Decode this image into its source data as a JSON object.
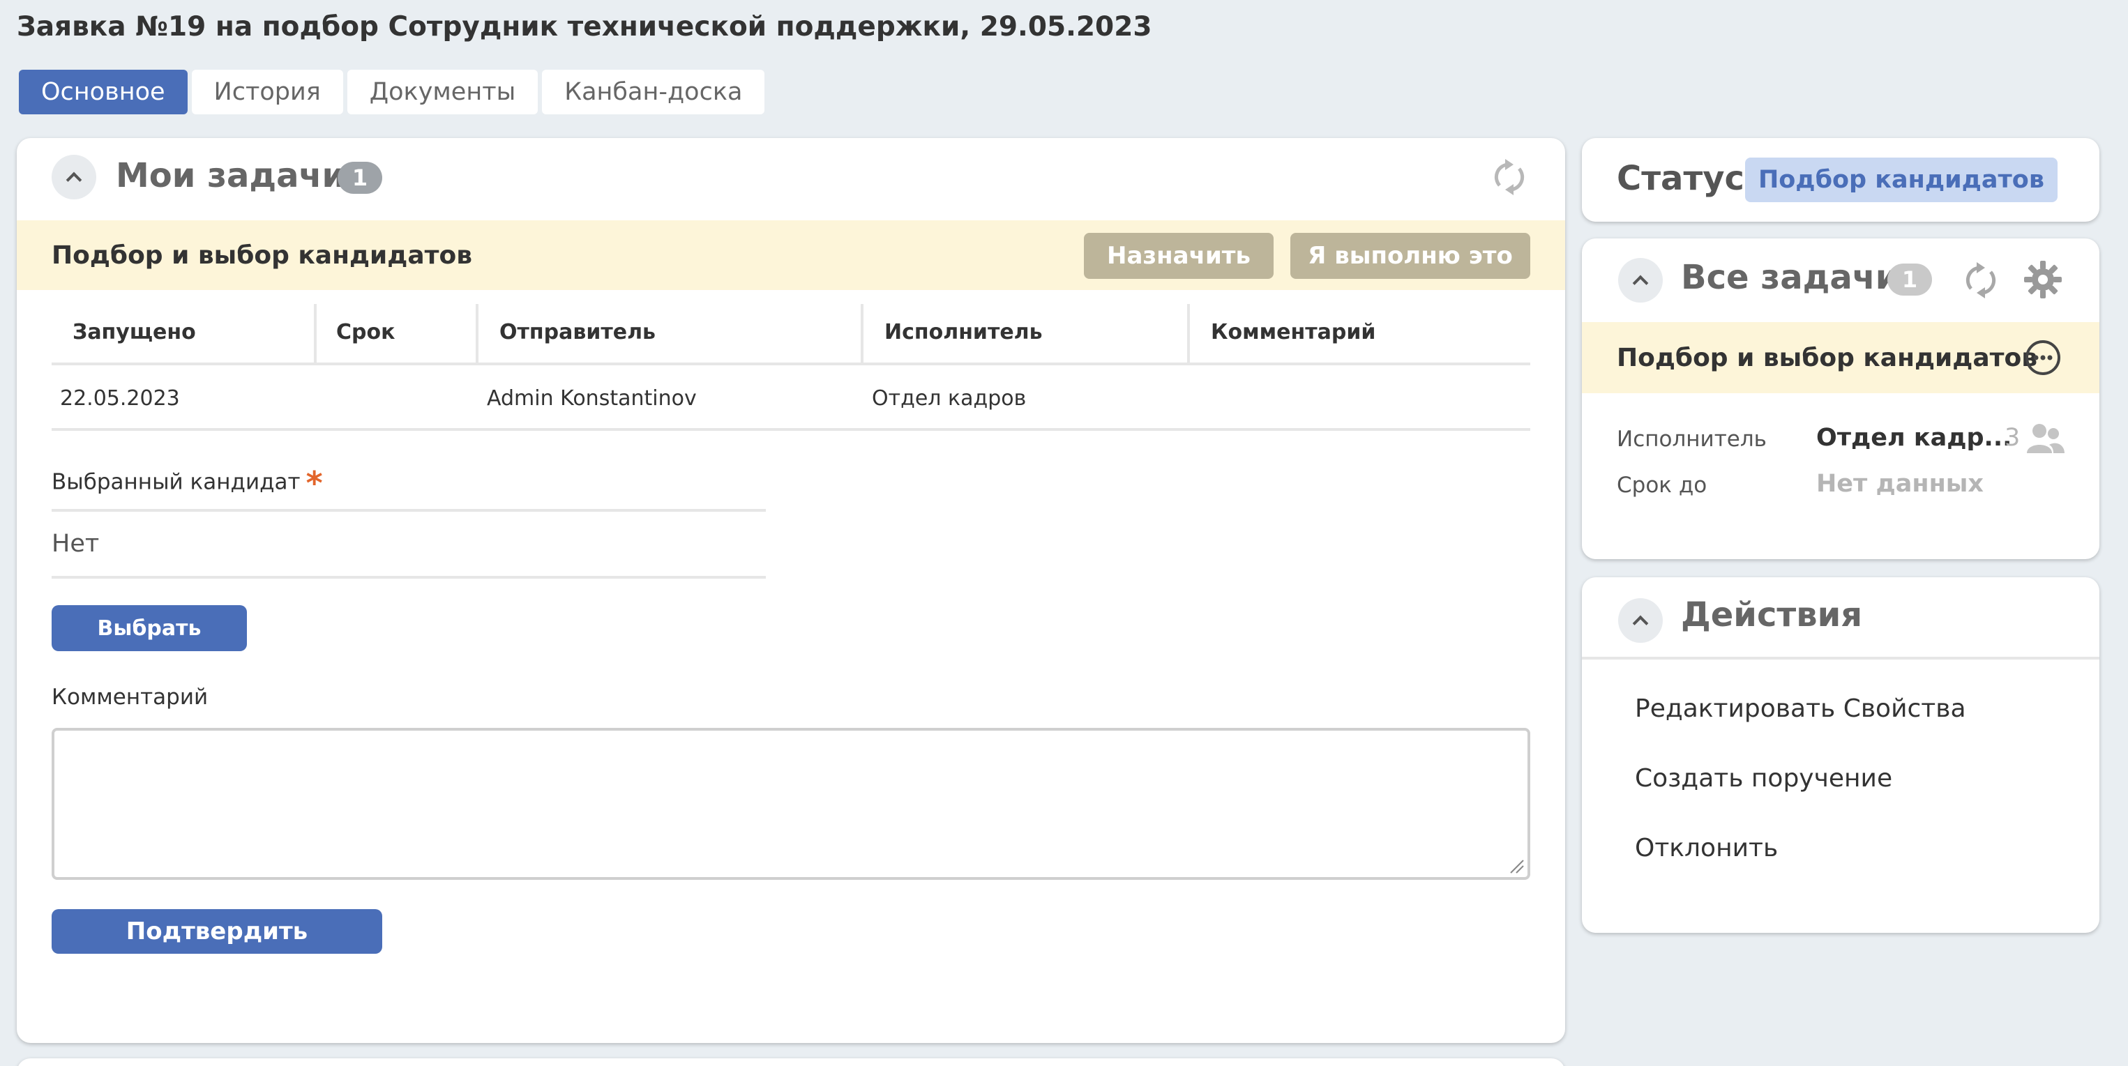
{
  "page": {
    "title": "Заявка №19 на подбор Сотрудник технической поддержки, 29.05.2023"
  },
  "tabs": [
    {
      "label": "Основное",
      "active": true
    },
    {
      "label": "История",
      "active": false
    },
    {
      "label": "Документы",
      "active": false
    },
    {
      "label": "Канбан-доска",
      "active": false
    }
  ],
  "my_tasks": {
    "title": "Мои задачи",
    "count": "1",
    "task_name": "Подбор и выбор кандидатов",
    "assign_label": "Назначить",
    "take_label": "Я выполню это",
    "columns": [
      "Запущено",
      "Срок",
      "Отправитель",
      "Исполнитель",
      "Комментарий"
    ],
    "rows": [
      {
        "started": "22.05.2023",
        "due": "",
        "sender": "Admin Konstantinov",
        "assignee": "Отдел кадров",
        "comment": ""
      }
    ],
    "candidate_label": "Выбранный кандидат",
    "required_mark": "*",
    "candidate_value": "Нет",
    "choose_label": "Выбрать",
    "comment_label": "Комментарий",
    "comment_value": "",
    "confirm_label": "Подтвердить"
  },
  "status": {
    "label": "Статус",
    "value": "Подбор кандидатов"
  },
  "all_tasks": {
    "title": "Все задачи",
    "count": "1",
    "task_name": "Подбор и выбор кандидатов",
    "assignee_label": "Исполнитель",
    "assignee_value": "Отдел кадр...",
    "assignee_count": "3",
    "due_label": "Срок до",
    "due_value": "Нет данных"
  },
  "actions": {
    "title": "Действия",
    "items": [
      "Редактировать Свойства",
      "Создать поручение",
      "Отклонить"
    ]
  },
  "colors": {
    "accent": "#4a6eb8",
    "task_bar": "#fdf5d9",
    "olive_button": "#bdb59a",
    "required": "#e2652b",
    "background": "#e9eef2"
  },
  "icons": [
    "chevron-up-icon",
    "refresh-icon",
    "gear-icon",
    "more-icon",
    "people-icon",
    "resize-grip-icon"
  ]
}
